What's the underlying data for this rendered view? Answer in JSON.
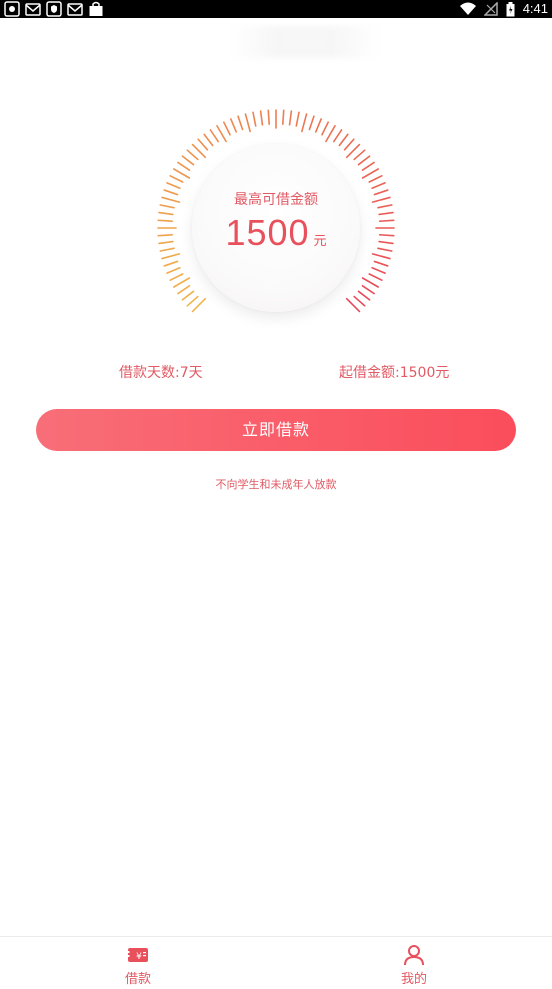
{
  "status_bar": {
    "time": "4:41",
    "icons": [
      "notification-icon",
      "mail-icon",
      "shield-icon",
      "mail-icon",
      "bag-icon",
      "wifi-icon",
      "signal-icon",
      "battery-icon"
    ]
  },
  "gauge": {
    "label": "最高可借金额",
    "amount": "1500",
    "unit": "元"
  },
  "loan_info": {
    "days": "借款天数:7天",
    "min_amount": "起借金额:1500元"
  },
  "borrow_button": {
    "label": "立即借款"
  },
  "notice": "不向学生和未成年人放款",
  "bottom_nav": {
    "items": [
      {
        "label": "借款",
        "icon": "loan-icon"
      },
      {
        "label": "我的",
        "icon": "user-icon"
      }
    ]
  },
  "colors": {
    "accent": "#e15a64",
    "button_start": "#f86e78",
    "button_end": "#fb4d5b",
    "gauge_start": "#f0b54a",
    "gauge_end": "#e8485a"
  }
}
